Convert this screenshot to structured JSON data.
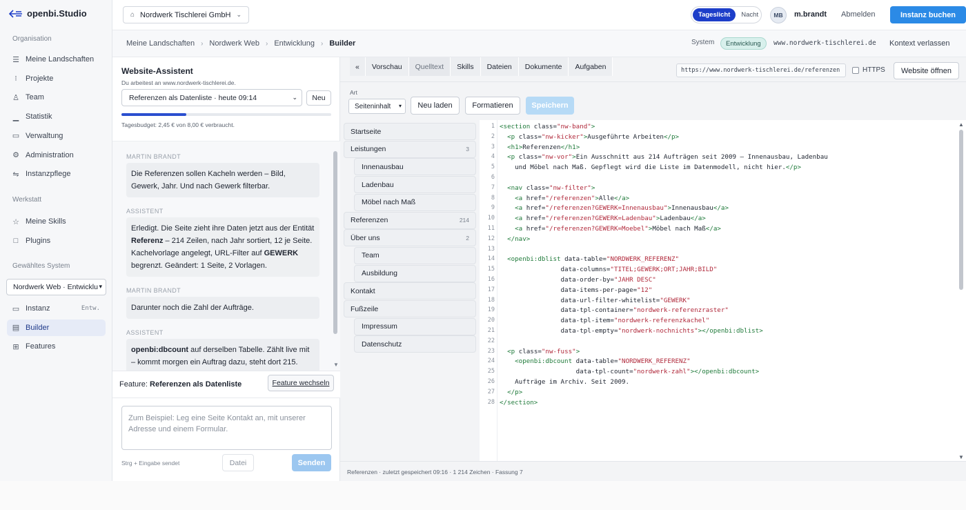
{
  "brand": "openbi.Studio",
  "sidebar": {
    "sections": {
      "org": "Organisation",
      "werkstatt": "Werkstatt",
      "system": "Gewähltes System"
    },
    "org_items": [
      {
        "label": "Meine Landschaften",
        "icon": "layers-icon"
      },
      {
        "label": "Projekte",
        "icon": "list-icon"
      },
      {
        "label": "Team",
        "icon": "user-icon"
      },
      {
        "label": "Statistik",
        "icon": "bar-chart-icon"
      },
      {
        "label": "Verwaltung",
        "icon": "window-icon"
      },
      {
        "label": "Administration",
        "icon": "gear-icon"
      },
      {
        "label": "Instanzpflege",
        "icon": "sliders-icon"
      }
    ],
    "werkstatt_items": [
      {
        "label": "Meine Skills",
        "icon": "star-icon"
      },
      {
        "label": "Plugins",
        "icon": "square-icon"
      }
    ],
    "system_select": "Nordwerk Web · Entwicklu",
    "system_items": [
      {
        "label": "Instanz",
        "tag": "Entw.",
        "icon": "window-icon"
      },
      {
        "label": "Builder",
        "icon": "builder-icon",
        "active": true
      },
      {
        "label": "Features",
        "icon": "features-icon"
      }
    ]
  },
  "topbar": {
    "tenant": "Nordwerk Tischlerei GmbH",
    "theme_on": "Tageslicht",
    "theme_off": "Nacht",
    "avatar": "MB",
    "user": "m.brandt",
    "logout": "Abmelden",
    "buy": "Instanz buchen"
  },
  "breadcrumb": {
    "items": [
      "Meine Landschaften",
      "Nordwerk Web",
      "Entwicklung",
      "Builder"
    ],
    "system_label": "System",
    "env_badge": "Entwicklung",
    "domain": "www.nordwerk-tischlerei.de",
    "exit": "Kontext verlassen"
  },
  "assistant": {
    "title": "Website-Assistent",
    "subtitle": "Du arbeitest an www.nordwerk-tischlerei.de.",
    "conversation": "Referenzen als Datenliste · heute 09:14",
    "new_label": "Neu",
    "budget_fraction": 0.31,
    "budget_text": "Tagesbudget: 2,45 € von 8,00 € verbraucht.",
    "messages": [
      {
        "who": "MARTIN BRANDT",
        "text": "Die Referenzen sollen Kacheln werden – Bild, Gewerk, Jahr. Und nach Gewerk filterbar."
      },
      {
        "who": "ASSISTENT",
        "text_a": "Erledigt. Die Seite zieht ihre Daten jetzt aus der Entität ",
        "bold_a": "Referenz",
        "text_b": " – 214 Zeilen, nach Jahr sortiert, 12 je Seite. Kachelvorlage angelegt, URL-Filter auf ",
        "bold_b": "GEWERK",
        "text_c": " begrenzt. Geändert: 1 Seite, 2 Vorlagen."
      },
      {
        "who": "MARTIN BRANDT",
        "text": "Darunter noch die Zahl der Aufträge."
      },
      {
        "who": "ASSISTENT",
        "bold": "openbi:dbcount",
        "text": " auf derselben Tabelle. Zählt live mit – kommt morgen ein Auftrag dazu, steht dort 215."
      }
    ],
    "feature_label": "Feature:",
    "feature_name": "Referenzen als Datenliste",
    "feature_switch": "Feature wechseln",
    "prompt_placeholder": "Zum Beispiel: Leg eine Seite Kontakt an, mit unserer Adresse und einem Formular.",
    "hint": "Strg + Eingabe sendet",
    "file_btn": "Datei",
    "send_btn": "Senden"
  },
  "builder": {
    "collapse": "«",
    "tabs": [
      "Vorschau",
      "Quelltext",
      "Skills",
      "Dateien",
      "Dokumente",
      "Aufgaben"
    ],
    "active_tab": "Quelltext",
    "url": "https://www.nordwerk-tischlerei.de/referenzen",
    "https_label": "HTTPS",
    "open_site": "Website öffnen",
    "art_label": "Art",
    "art_value": "Seiteninhalt",
    "reload": "Neu laden",
    "format": "Formatieren",
    "save": "Speichern",
    "tree": [
      {
        "label": "Startseite",
        "level": 0
      },
      {
        "label": "Leistungen",
        "level": 0,
        "count": "3"
      },
      {
        "label": "Innenausbau",
        "level": 1
      },
      {
        "label": "Ladenbau",
        "level": 1
      },
      {
        "label": "Möbel nach Maß",
        "level": 1
      },
      {
        "label": "Referenzen",
        "level": 0,
        "count": "214"
      },
      {
        "label": "Über uns",
        "level": 0,
        "count": "2"
      },
      {
        "label": "Team",
        "level": 1
      },
      {
        "label": "Ausbildung",
        "level": 1
      },
      {
        "label": "Kontakt",
        "level": 0
      },
      {
        "label": "Fußzeile",
        "level": 0
      },
      {
        "label": "Impressum",
        "level": 1
      },
      {
        "label": "Datenschutz",
        "level": 1
      }
    ],
    "code": [
      "<section class=\"nw-band\">",
      "  <p class=\"nw-kicker\">Ausgeführte Arbeiten</p>",
      "  <h1>Referenzen</h1>",
      "  <p class=\"nw-vor\">Ein Ausschnitt aus 214 Aufträgen seit 2009 — Innenausbau, Ladenbau",
      "    und Möbel nach Maß. Gepflegt wird die Liste im Datenmodell, nicht hier.</p>",
      "",
      "  <nav class=\"nw-filter\">",
      "    <a href=\"/referenzen\">Alle</a>",
      "    <a href=\"/referenzen?GEWERK=Innenausbau\">Innenausbau</a>",
      "    <a href=\"/referenzen?GEWERK=Ladenbau\">Ladenbau</a>",
      "    <a href=\"/referenzen?GEWERK=Moebel\">Möbel nach Maß</a>",
      "  </nav>",
      "",
      "  <openbi:dblist data-table=\"NORDWERK_REFERENZ\"",
      "                data-columns=\"TITEL;GEWERK;ORT;JAHR;BILD\"",
      "                data-order-by=\"JAHR DESC\"",
      "                data-items-per-page=\"12\"",
      "                data-url-filter-whitelist=\"GEWERK\"",
      "                data-tpl-container=\"nordwerk-referenzraster\"",
      "                data-tpl-item=\"nordwerk-referenzkachel\"",
      "                data-tpl-empty=\"nordwerk-nochnichts\"></openbi:dblist>",
      "",
      "  <p class=\"nw-fuss\">",
      "    <openbi:dbcount data-table=\"NORDWERK_REFERENZ\"",
      "                    data-tpl-count=\"nordwerk-zahl\"></openbi:dbcount>",
      "    Aufträge im Archiv. Seit 2009.",
      "  </p>",
      "</section>"
    ],
    "status": "Referenzen · zuletzt gespeichert 09:16 · 1 214 Zeichen · Fassung 7"
  }
}
